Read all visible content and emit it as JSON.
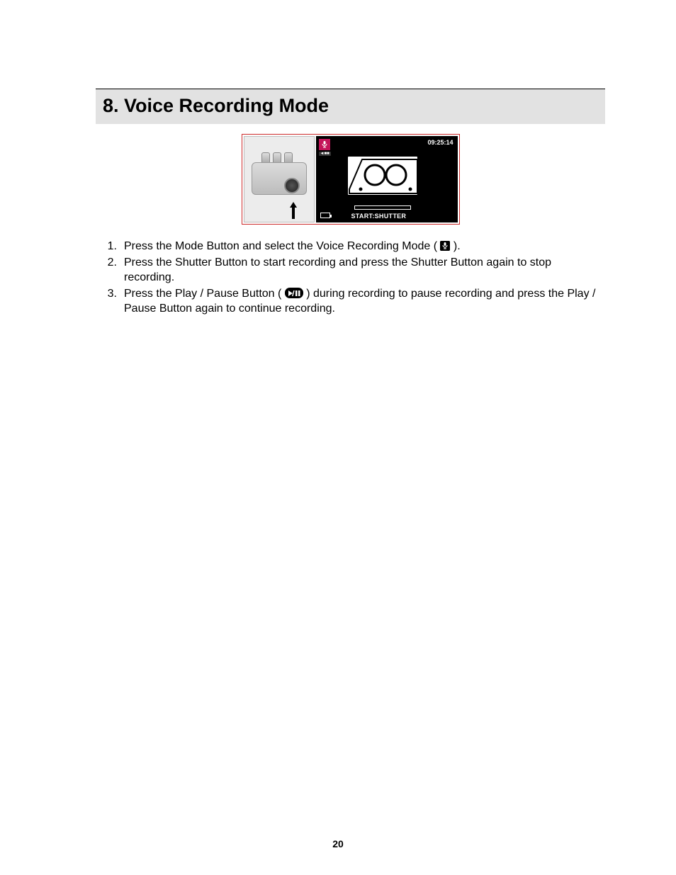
{
  "heading": "8. Voice Recording Mode",
  "screen": {
    "timer": "09:25:14",
    "start_label": "START:SHUTTER"
  },
  "steps": [
    {
      "num": "1.",
      "pre": "Press the Mode Button and select the Voice Recording Mode ( ",
      "icon": "mic",
      "post": " )."
    },
    {
      "num": "2.",
      "pre": "Press the Shutter Button to start recording and press the Shutter Button again to stop recording.",
      "icon": null,
      "post": ""
    },
    {
      "num": "3.",
      "pre": "Press the Play / Pause Button ( ",
      "icon": "playpause",
      "post": " ) during recording to pause recording and press the Play / Pause Button again to continue recording."
    }
  ],
  "page_number": "20"
}
